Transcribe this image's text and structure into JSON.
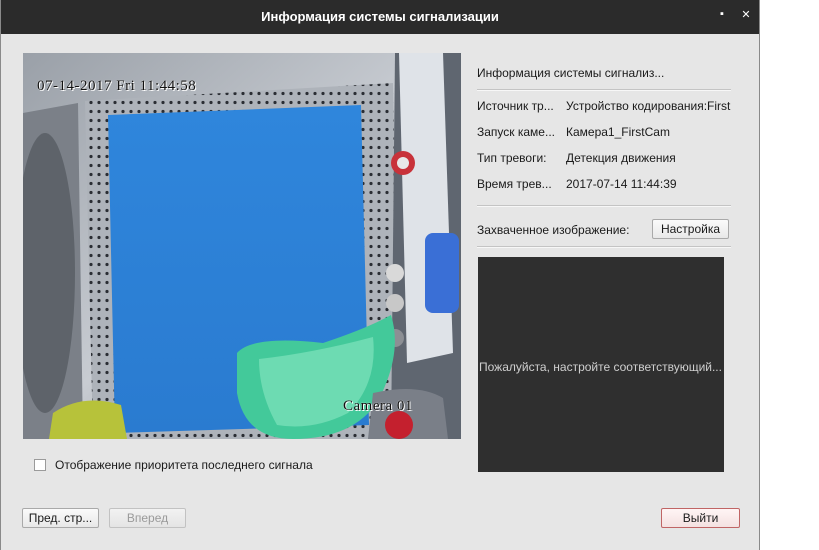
{
  "window": {
    "title": "Информация системы сигнализации",
    "restore_glyph": "▪",
    "close_glyph": "✕"
  },
  "video": {
    "osd_date": "07-14-2017 Fri 11:44:58",
    "osd_camera": "Camera 01"
  },
  "checkbox": {
    "label": "Отображение приоритета последнего сигнала",
    "checked": false
  },
  "info": {
    "section_title": "Информация системы сигнализ...",
    "rows": [
      {
        "label": "Источник тр...",
        "value": "Устройство кодирования:First"
      },
      {
        "label": "Запуск каме...",
        "value": "Камера1_FirstCam"
      },
      {
        "label": "Тип тревоги:",
        "value": "Детекция движения"
      },
      {
        "label": "Время трев...",
        "value": "2017-07-14 11:44:39"
      }
    ]
  },
  "capture": {
    "label": "Захваченное изображение:",
    "setup_button": "Настройка",
    "preview_message": "Пожалуйста, настройте соответствующий..."
  },
  "footer": {
    "prev_button": "Пред. стр...",
    "next_button": "Вперед",
    "exit_button": "Выйти"
  },
  "colors": {
    "titlebar": "#2b2b2b",
    "window_bg": "#e6e6e6",
    "preview_bg": "#2f2f2f",
    "exit_border": "#c06565"
  }
}
